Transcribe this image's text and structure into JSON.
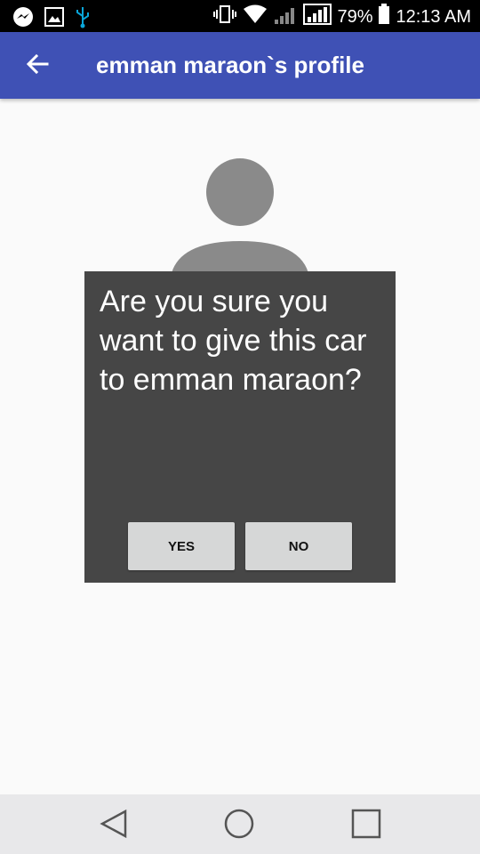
{
  "status_bar": {
    "battery_percent": "79%",
    "time": "12:13 AM",
    "icons": [
      "messenger-icon",
      "gallery-icon",
      "usb-icon",
      "vibrate-icon",
      "wifi-icon",
      "signal-icon",
      "signal-icon",
      "battery-icon"
    ]
  },
  "app_bar": {
    "title": "emman maraon`s profile",
    "back_icon": "arrow-back-icon",
    "color": "#3f51b5"
  },
  "avatar": {
    "icon": "person-placeholder-icon"
  },
  "dialog": {
    "message": "Are you sure you want to give this car to emman maraon?",
    "yes_label": "YES",
    "no_label": "NO",
    "background": "#464646"
  },
  "nav_bar": {
    "back_icon": "triangle-back-icon",
    "home_icon": "circle-home-icon",
    "recents_icon": "square-recents-icon"
  }
}
